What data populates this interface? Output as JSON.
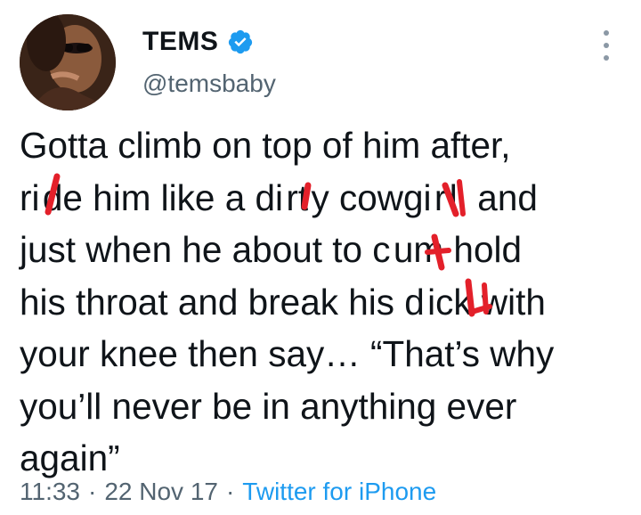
{
  "user": {
    "display_name": "TEMS",
    "handle": "@temsbaby",
    "verified": true
  },
  "tweet": {
    "text": "Gotta climb on top of him after,\nri de him like a di rt y cowgi r l, and\njust when he about to c um hold\nhis throat and break his d ick  with\nyour knee then say… “That’s why\nyou’ll never be in anything ever\nagain”"
  },
  "meta": {
    "time": "11:33",
    "separator": "·",
    "date": "22 Nov 17",
    "source": "Twitter for iPhone"
  },
  "colors": {
    "text": "#0f1419",
    "secondary": "#536471",
    "link": "#1d9bf0",
    "verified": "#1d9bf0",
    "scribble": "#e3202a"
  },
  "icons": {
    "verified": "verified-badge-icon",
    "more": "more-options-icon"
  }
}
